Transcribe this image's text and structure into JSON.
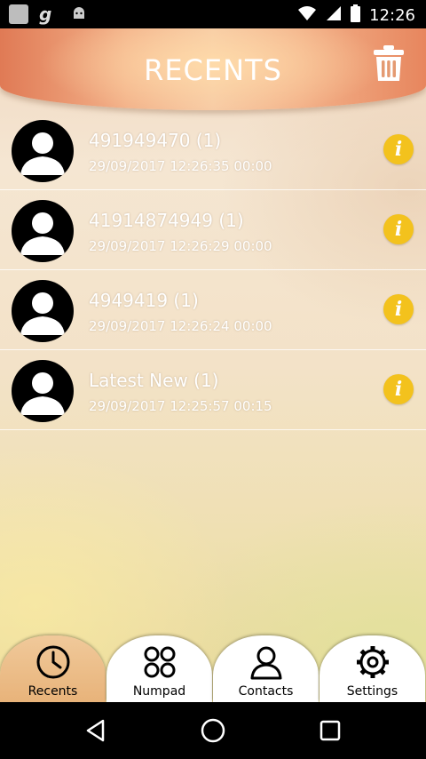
{
  "status_bar": {
    "time": "12:26",
    "left_icons": [
      "app-icon",
      "g-icon",
      "android-icon"
    ],
    "right_icons": [
      "wifi-icon",
      "signal-icon",
      "battery-icon"
    ]
  },
  "header": {
    "title": "RECENTS",
    "delete_icon": "trash-icon"
  },
  "calls": [
    {
      "name": "491949470 (1)",
      "details": "29/09/2017 12:26:35 00:00"
    },
    {
      "name": "41914874949 (1)",
      "details": "29/09/2017 12:26:29 00:00"
    },
    {
      "name": "4949419 (1)",
      "details": "29/09/2017 12:26:24 00:00"
    },
    {
      "name": "Latest New (1)",
      "details": "29/09/2017 12:25:57 00:15"
    }
  ],
  "info_glyph": "i",
  "tabs": [
    {
      "label": "Recents",
      "icon": "clock-icon",
      "active": true
    },
    {
      "label": "Numpad",
      "icon": "numpad-icon",
      "active": false
    },
    {
      "label": "Contacts",
      "icon": "person-icon",
      "active": false
    },
    {
      "label": "Settings",
      "icon": "gear-icon",
      "active": false
    }
  ],
  "colors": {
    "info_badge": "#f3c21d",
    "header_accent": "#e07a55",
    "active_tab": "#e8b37a"
  }
}
